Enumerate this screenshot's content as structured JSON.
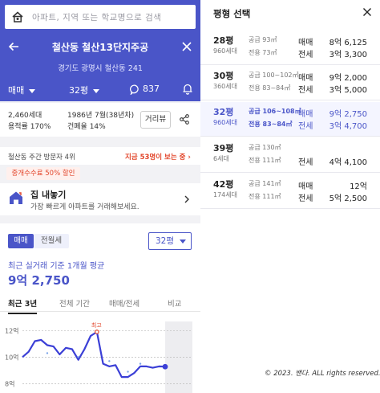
{
  "colors": {
    "brand": "#4a55c8",
    "accent_red": "#e2452a",
    "line": "#3b3fd6"
  },
  "search": {
    "placeholder": "아파트, 지역 또는 학교명으로 검색"
  },
  "header": {
    "title": "철산동 철산13단지주공",
    "address": "경기도 광명시 철산동 241",
    "trade_type": "매매",
    "area": "32평",
    "comment_count": "837"
  },
  "info": {
    "households": "2,460세대",
    "floor_area_ratio": "용적률 170%",
    "approval": "1986년 7월(38년차)",
    "coverage_ratio": "건폐율 14%",
    "distance_button": "거리뷰"
  },
  "visitors": {
    "label": "철산동 주간 방문자 4위",
    "hot_text": "지금 53명이 보는 중 ›"
  },
  "promo": "중개수수료 50% 할인",
  "sell": {
    "title": "집 내놓기",
    "subtitle": "가장 빠르게 아파트를 거래해보세요."
  },
  "price": {
    "tab_sale": "매매",
    "tab_rent": "전월세",
    "area_select": "32평",
    "avg_caption": "최근 실거래 기준 1개월 평균",
    "avg_value": "9억 2,750",
    "ranges": [
      "최근 3년",
      "전체 기간",
      "매매/전세",
      "비교"
    ]
  },
  "chart_data": {
    "type": "line",
    "y_ticks": [
      "12억",
      "10억",
      "8억"
    ],
    "ylim": [
      7.6,
      12.2
    ],
    "annotation": "최고",
    "series": [
      {
        "values": [
          10.0,
          10.4,
          11.2,
          11.3,
          10.9,
          10.8,
          10.2,
          10.7,
          10.6,
          9.8,
          10.6,
          11.6,
          11.9,
          9.5,
          9.3,
          9.4,
          8.5,
          8.5,
          8.8,
          9.3,
          9.3,
          9.2,
          9.3,
          9.28
        ]
      }
    ],
    "grid": true
  },
  "right": {
    "title": "평형 선택",
    "rows": [
      {
        "pyeong": "28평",
        "households": "960세대",
        "supply": "공급 93㎡",
        "exclusive": "전용 73㎡",
        "sale_label": "매매",
        "sale": "8억 6,125",
        "jeonse_label": "전세",
        "jeonse": "3억 3,300",
        "selected": false
      },
      {
        "pyeong": "30평",
        "households": "360세대",
        "supply": "공급 100~102㎡",
        "exclusive": "전용 83~84㎡",
        "sale_label": "매매",
        "sale": "9억 2,000",
        "jeonse_label": "전세",
        "jeonse": "3억 5,000",
        "selected": false
      },
      {
        "pyeong": "32평",
        "households": "960세대",
        "supply": "공급 106~108㎡",
        "exclusive": "전용 83~84㎡",
        "sale_label": "매매",
        "sale": "9억 2,750",
        "jeonse_label": "전세",
        "jeonse": "3억 4,700",
        "selected": true
      },
      {
        "pyeong": "39평",
        "households": "6세대",
        "supply": "공급 130㎡",
        "exclusive": "전용 111㎡",
        "sale_label": "",
        "sale": "",
        "jeonse_label": "전세",
        "jeonse": "4억 4,100",
        "selected": false
      },
      {
        "pyeong": "42평",
        "households": "174세대",
        "supply": "공급 141㎡",
        "exclusive": "전용 111㎡",
        "sale_label": "매매",
        "sale": "12억",
        "jeonse_label": "전세",
        "jeonse": "5억 2,500",
        "selected": false
      }
    ],
    "copyright": "© 2023. 밴다. ALL rights reserved."
  }
}
